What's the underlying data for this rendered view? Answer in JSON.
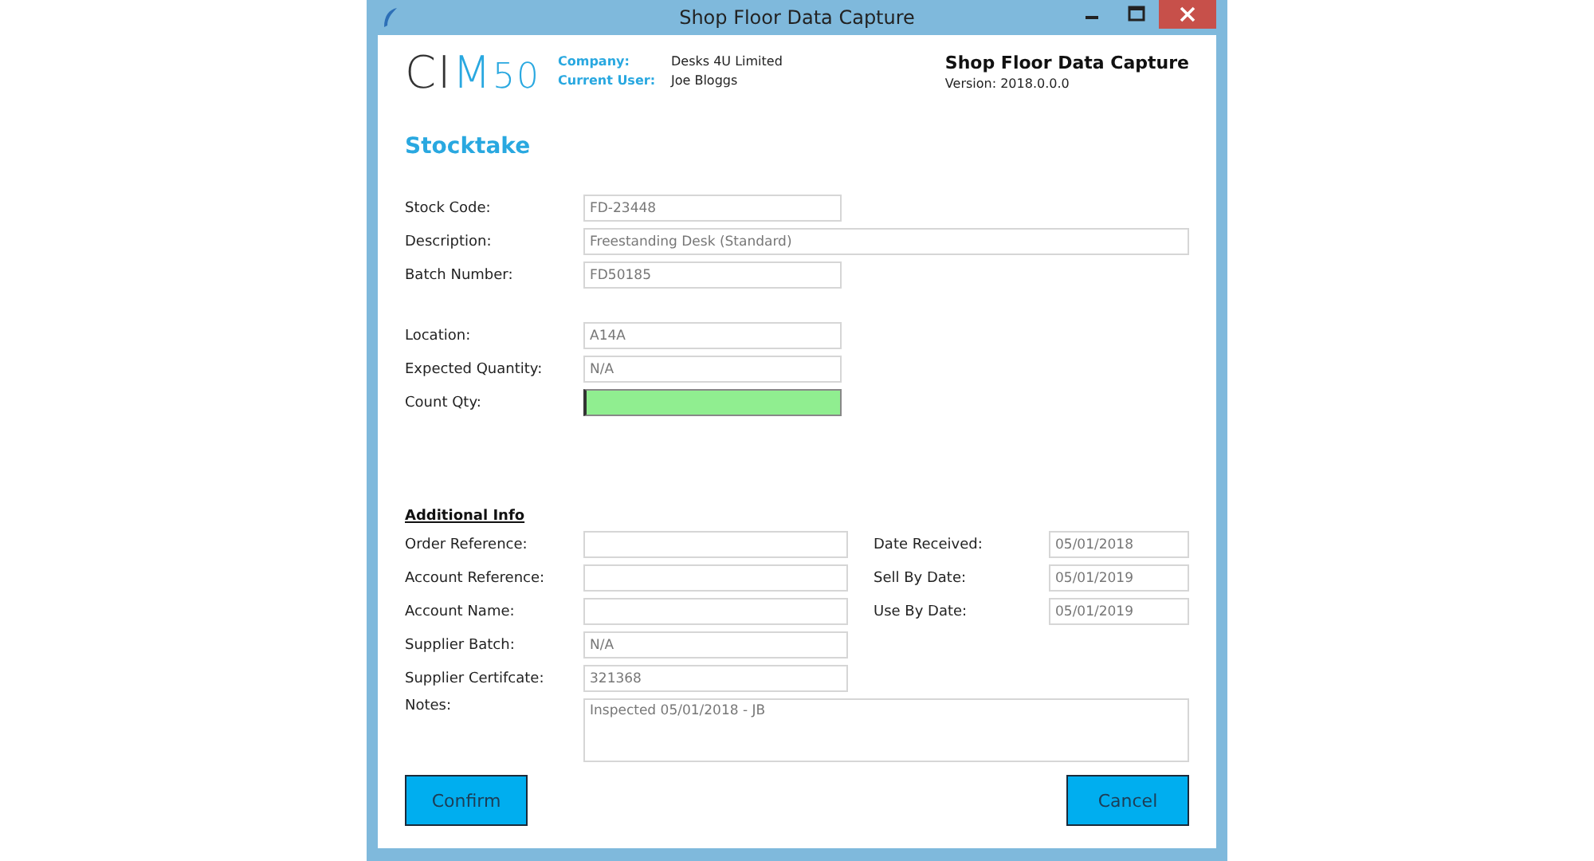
{
  "window": {
    "title": "Shop Floor Data Capture"
  },
  "header": {
    "logo": "CIM50",
    "company_label": "Company:",
    "company": "Desks 4U Limited",
    "user_label": "Current User:",
    "user": "Joe Bloggs",
    "app_title": "Shop Floor Data Capture",
    "version": "Version: 2018.0.0.0"
  },
  "page_title": "Stocktake",
  "main_fields": [
    {
      "label": "Stock Code:",
      "value": "FD-23448",
      "wide": false,
      "highlighted": false
    },
    {
      "label": "Description:",
      "value": "Freestanding Desk (Standard)",
      "wide": true,
      "highlighted": false
    },
    {
      "label": "Batch Number:",
      "value": "FD50185",
      "wide": false,
      "highlighted": false
    }
  ],
  "location_fields": [
    {
      "label": "Location:",
      "value": "A14A",
      "wide": false,
      "highlighted": false
    },
    {
      "label": "Expected Quantity:",
      "value": "N/A",
      "wide": false,
      "highlighted": false
    },
    {
      "label": "Count Qty:",
      "wide": false,
      "highlighted": true
    }
  ],
  "additional": {
    "heading": "Additional Info",
    "left_fields": [
      {
        "label": "Order Reference:"
      },
      {
        "label": "Account Reference:"
      },
      {
        "label": "Account Name:"
      },
      {
        "label": "Supplier Batch:",
        "value": "N/A"
      },
      {
        "label": "Supplier Certifcate:",
        "value": "321368"
      }
    ],
    "right_fields": [
      {
        "label": "Date Received:",
        "value": "05/01/2018"
      },
      {
        "label": "Sell By Date:",
        "value": "05/01/2019"
      },
      {
        "label": "Use By Date:",
        "value": "05/01/2019"
      }
    ],
    "notes": {
      "label": "Notes:",
      "value": "Inspected 05/01/2018 - JB"
    }
  },
  "buttons": [
    "Confirm",
    "Cancel"
  ]
}
